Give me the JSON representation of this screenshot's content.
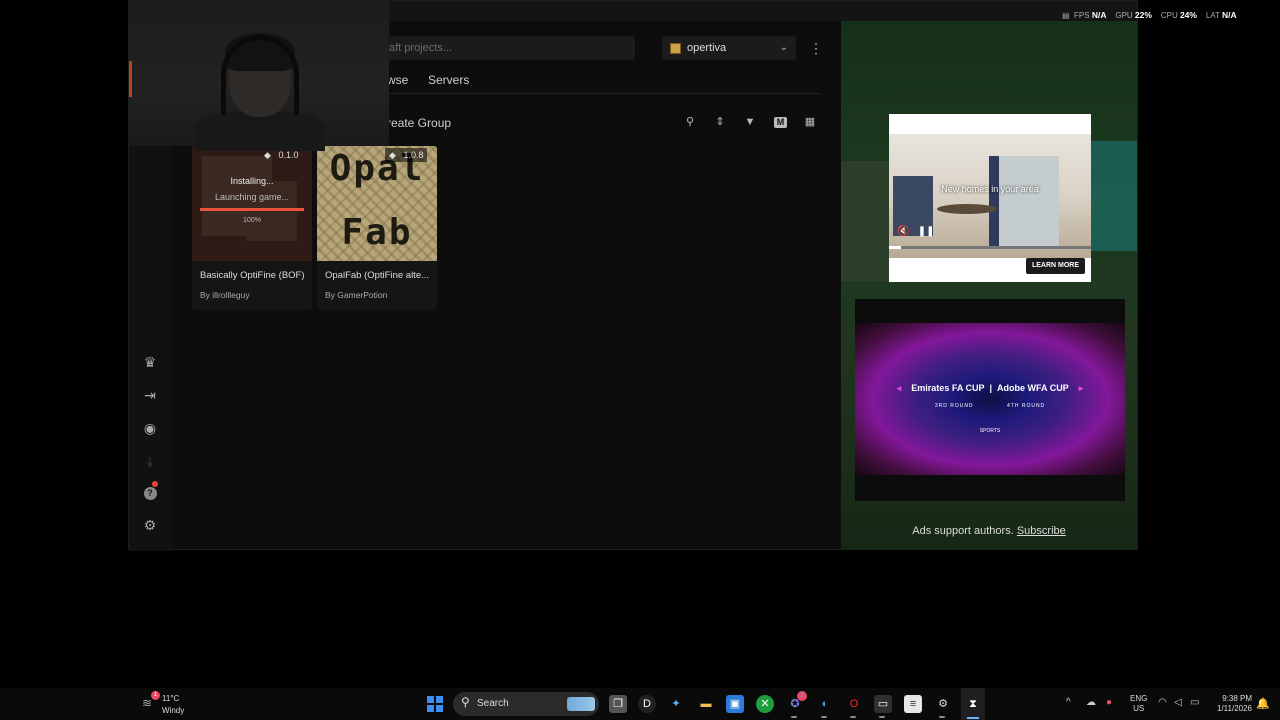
{
  "app": {
    "search_placeholder": "aft projects...",
    "profile": {
      "name": "opertiva"
    },
    "tabs": [
      {
        "label": "wse"
      },
      {
        "label": "Servers"
      }
    ],
    "create_group_label": "reate Group",
    "sidebar_icons": [
      "crown-icon",
      "login-icon",
      "discord-icon",
      "download-icon",
      "help-icon",
      "gear-icon"
    ],
    "toolbar_icons": [
      "search-icon",
      "sort-icon",
      "filter-icon",
      "m-icon",
      "grid-icon"
    ],
    "modpacks": [
      {
        "title": "Basically OptiFine (BOF)",
        "author": "By illrollleguy",
        "version": "0.1.0",
        "status": "Installing...",
        "substatus": "Launching game...",
        "progress": 100,
        "progress_label": "100%"
      },
      {
        "title": "OpalFab (OptiFine alte...",
        "author": "By GamerPotion",
        "version": "1.0.8",
        "thumb_line1": "Opal",
        "thumb_line2": "Fab"
      }
    ]
  },
  "ads": {
    "video_caption": "New homes in your area",
    "learn_more": "LEARN MORE",
    "video_progress": 0.06,
    "banner_left": "Emirates FA CUP",
    "banner_right": "Adobe WFA CUP",
    "banner_round_left": "3RD ROUND",
    "banner_round_right": "4TH ROUND",
    "banner_sponsor": "SPORTS",
    "support_text": "Ads support authors.",
    "subscribe_label": "Subscribe"
  },
  "overlay_stats": {
    "fps_label": "FPS",
    "fps_value": "N/A",
    "gpu_label": "GPU",
    "gpu_value": "22%",
    "cpu_label": "CPU",
    "cpu_value": "24%",
    "lat_label": "LAT",
    "lat_value": "N/A"
  },
  "taskbar": {
    "weather_temp": "11°C",
    "weather_cond": "Windy",
    "weather_badge": "1",
    "search_label": "Search",
    "teams_badge": "2",
    "lang_line1": "ENG",
    "lang_line2": "US",
    "time": "9:38 PM",
    "date": "1/11/2026",
    "accent": "#3a8ff0"
  }
}
